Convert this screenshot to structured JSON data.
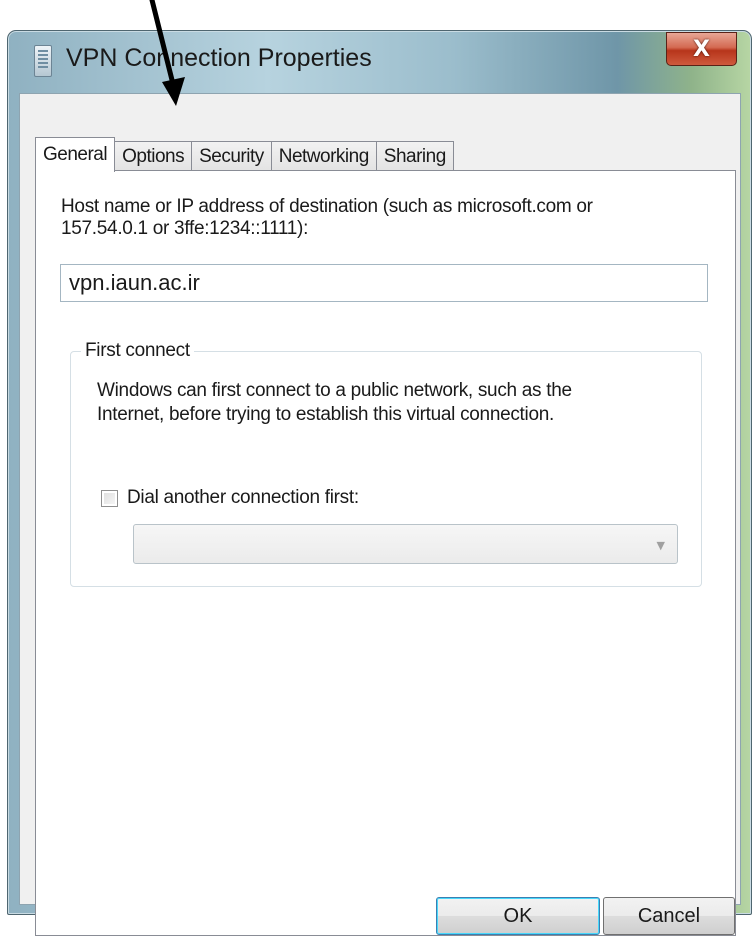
{
  "window": {
    "title": "VPN Connection Properties",
    "close_glyph": "X"
  },
  "tabs": [
    {
      "label": "General",
      "active": true
    },
    {
      "label": "Options",
      "active": false
    },
    {
      "label": "Security",
      "active": false
    },
    {
      "label": "Networking",
      "active": false
    },
    {
      "label": "Sharing",
      "active": false
    }
  ],
  "general": {
    "host_label_line1": "Host name or IP address of destination (such as microsoft.com or",
    "host_label_line2": "157.54.0.1 or 3ffe:1234::1111):",
    "host_value": "vpn.iaun.ac.ir",
    "first_connect": {
      "title": "First connect",
      "description_line1": "Windows can first connect to a public network, such as the",
      "description_line2": "Internet, before trying to establish this virtual connection.",
      "dial_checkbox_label": "Dial another connection first:",
      "dial_checked": false,
      "dial_selected_value": ""
    }
  },
  "buttons": {
    "ok": "OK",
    "cancel": "Cancel"
  },
  "annotation": {
    "arrow_target": "Options tab",
    "arrow_color": "#000000"
  }
}
